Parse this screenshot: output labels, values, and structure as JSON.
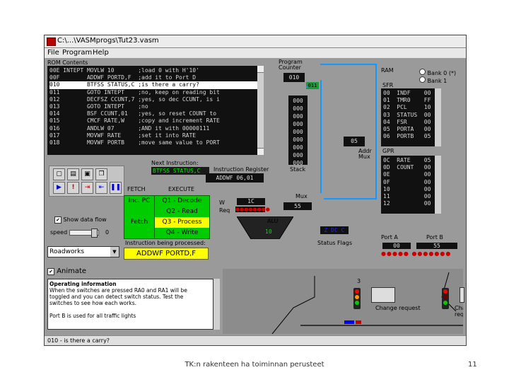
{
  "window": {
    "title": "C:\\...\\VASMprogs\\Tut23.vasm"
  },
  "menu": [
    "File",
    "Program",
    "Help"
  ],
  "rom": {
    "title": "ROM Contents",
    "rows": [
      {
        "addr": "00E",
        "label": "INTEPT",
        "instr": "MOVLW 10",
        "comment": ";load 0 with H'10'"
      },
      {
        "addr": "00F",
        "label": "",
        "instr": "ADDWF PORTD,F",
        "comment": ";add it to Port D"
      },
      {
        "addr": "010",
        "label": "",
        "instr": "BTFSS STATUS,C",
        "comment": ";is there a carry?"
      },
      {
        "addr": "011",
        "label": "",
        "instr": "GOTO INTEPT",
        "comment": ";no, keep on reading bit"
      },
      {
        "addr": "012",
        "label": "",
        "instr": "DECFSZ CCUNT,7",
        "comment": ";yes, so dec CCUNT, is i"
      },
      {
        "addr": "013",
        "label": "",
        "instr": "GOTO INTEPT",
        "comment": ";no"
      },
      {
        "addr": "014",
        "label": "",
        "instr": "BSF CCUNT,01",
        "comment": ";yes, so reset COUNT to"
      },
      {
        "addr": "015",
        "label": "",
        "instr": "CMCF RATE,W",
        "comment": ";copy and increment RATE"
      },
      {
        "addr": "016",
        "label": "",
        "instr": "ANDLW 07",
        "comment": ";AND it with 00000111"
      },
      {
        "addr": "017",
        "label": "",
        "instr": "MOVWF RATE",
        "comment": ";set it into RATE"
      },
      {
        "addr": "018",
        "label": "",
        "instr": "MOVWF PORTB",
        "comment": ";move same value to PORT"
      }
    ],
    "highlight_index": 2
  },
  "program_counter": {
    "label": "Program Counter",
    "value": "010",
    "side_value": "011"
  },
  "stack": {
    "label": "Stack",
    "values": [
      "000",
      "000",
      "000",
      "000",
      "000",
      "000",
      "000",
      "000",
      "000"
    ]
  },
  "next_instruction": {
    "label": "Next Instruction:",
    "value": "BTFSS STATUS,C"
  },
  "instruction_register": {
    "label": "Instruction Register",
    "value": "ADDWF 06,01"
  },
  "wreg": {
    "value": "05",
    "label": "Addr Mux"
  },
  "ram": {
    "label": "RAM",
    "bank0": "Bank 0 (*)",
    "bank1": "Bank 1",
    "sfr": "SFR",
    "sfr_rows": [
      {
        "a": "00",
        "n": "INDF",
        "v": "00"
      },
      {
        "a": "01",
        "n": "TMR0",
        "v": "FF"
      },
      {
        "a": "02",
        "n": "PCL",
        "v": "10"
      },
      {
        "a": "03",
        "n": "STATUS",
        "v": "00"
      },
      {
        "a": "04",
        "n": "FSR",
        "v": "00"
      },
      {
        "a": "05",
        "n": "PORTA",
        "v": "00"
      },
      {
        "a": "06",
        "n": "PORTB",
        "v": "05"
      }
    ],
    "gpr": "GPR",
    "gpr_rows": [
      {
        "a": "0C",
        "n": "RATE",
        "v": "05"
      },
      {
        "a": "0D",
        "n": "COUNT",
        "v": "00"
      },
      {
        "a": "0E",
        "n": "",
        "v": "00"
      },
      {
        "a": "0F",
        "n": "",
        "v": "00"
      },
      {
        "a": "10",
        "n": "",
        "v": "00"
      },
      {
        "a": "11",
        "n": "",
        "v": "00"
      },
      {
        "a": "12",
        "n": "",
        "v": "00"
      }
    ]
  },
  "cycle": {
    "fetch": "FETCH",
    "execute": "EXECUTE",
    "rows": [
      {
        "l": "Inc. PC",
        "q": "Q1 - Decode"
      },
      {
        "l": "",
        "q": "Q2 - Read"
      },
      {
        "l": "Fetch",
        "q": "Q3 - Process"
      },
      {
        "l": "",
        "q": "Q4 - Write"
      }
    ],
    "active": 2,
    "processing_label": "Instruction being processed:",
    "processing_value": "ADDWF PORTD,F"
  },
  "mux": {
    "label": "Mux",
    "value": "55"
  },
  "w": {
    "label": "W",
    "value": "1C"
  },
  "req": {
    "label": "Req"
  },
  "alu": {
    "label": "ALU",
    "value": "10"
  },
  "status_flags": {
    "label": "Status Flags",
    "value": "Z DC C"
  },
  "controls": {
    "show_data_flow": "Show data flow",
    "speed": "speed",
    "speed_value": "0",
    "dropdown": "Roadworks",
    "animate": "Animate"
  },
  "port_a": {
    "label": "Port A",
    "value": "00"
  },
  "port_b": {
    "label": "Port B",
    "value": "55"
  },
  "info": {
    "title": "Operating information",
    "lines": [
      "When the switches are pressed RA0 and RA1 will be",
      "toggled and you can detect switch status. Test the",
      "switches to see how each works.",
      "",
      "Port B is used for all traffic lights"
    ]
  },
  "status_bar": "010 - is there a carry?",
  "sim": {
    "change_request": "Change request",
    "counter": "3"
  },
  "footer": {
    "caption": "TK:n rakenteen ha toiminnan perusteet",
    "page": "11"
  }
}
